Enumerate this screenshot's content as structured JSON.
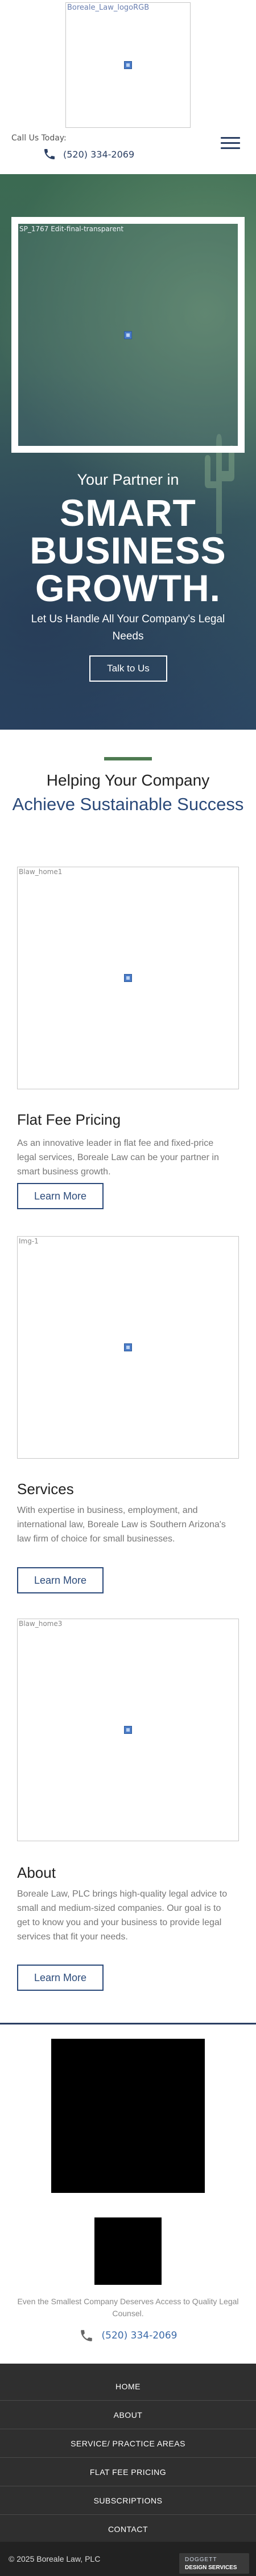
{
  "header": {
    "logo_alt": "Boreale_Law_logoRGB",
    "call_label": "Call Us Today:",
    "phone": "(520) 334-2069",
    "menu_icon": "hamburger-menu-icon"
  },
  "hero": {
    "image_alt": "SP_1767 Edit-final-transparent",
    "subtitle": "Your Partner in",
    "title_line1": "SMART",
    "title_line2": "BUSINESS",
    "title_line3": "GROWTH.",
    "description": "Let Us Handle All Your Company's Legal Needs",
    "button_label": "Talk to Us"
  },
  "intro": {
    "heading": "Helping Your Company",
    "subheading": "Achieve Sustainable Success"
  },
  "blocks": [
    {
      "image_alt": "Blaw_home1",
      "title": "Flat Fee Pricing",
      "text": "As an innovative leader in flat fee and fixed-price legal services, Boreale Law can be your partner in smart business growth.",
      "button_label": "Learn More"
    },
    {
      "image_alt": "Img-1",
      "title": "Services",
      "text": "With expertise in business, employment, and international law, Boreale Law is Southern Arizona's law firm of choice for small businesses.",
      "button_label": "Learn More"
    },
    {
      "image_alt": "Blaw_home3",
      "title": "About",
      "text": "Boreale Law, PLC brings high-quality legal advice to small and medium-sized companies. Our goal is to get to know you and your business to provide legal services that fit your needs.",
      "button_label": "Learn More"
    }
  ],
  "footer": {
    "tagline": "Even the Smallest Company Deserves Access to Quality Legal Counsel.",
    "phone": "(520) 334-2069",
    "nav": [
      "HOME",
      "ABOUT",
      "SERVICE/ PRACTICE AREAS",
      "FLAT FEE PRICING",
      "SUBSCRIPTIONS",
      "CONTACT"
    ],
    "copyright": "© 2025 Boreale Law, PLC",
    "designer_line1": "DOGGETT",
    "designer_line2": "DESIGN SERVICES"
  },
  "colors": {
    "navy": "#2b3f63",
    "blue_text": "#2b4a7a",
    "green_rule": "#4d7a50",
    "footer_dark": "#2f2f2f"
  }
}
